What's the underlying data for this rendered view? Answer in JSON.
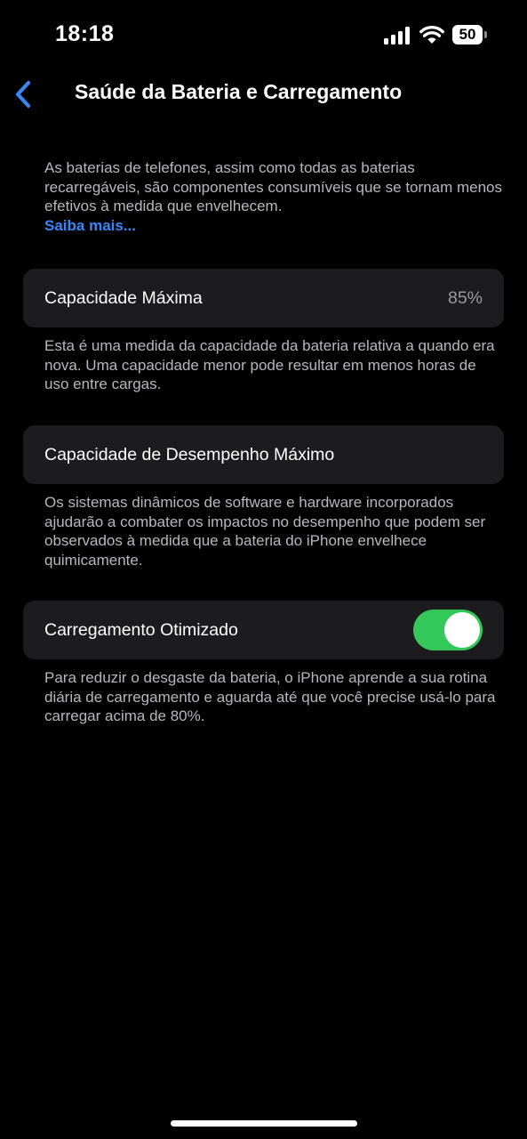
{
  "status_bar": {
    "time": "18:18",
    "battery_level": "50",
    "icons": [
      "signal-icon",
      "wifi-icon",
      "battery-icon"
    ]
  },
  "nav": {
    "back_icon": "chevron-left-icon",
    "title": "Saúde da Bateria e Carregamento"
  },
  "intro": {
    "text": "As baterias de telefones, assim como todas as baterias recarregáveis, são componentes consumíveis que se tornam menos efetivos à medida que envelhecem.",
    "link": "Saiba mais..."
  },
  "max_capacity": {
    "label": "Capacidade Máxima",
    "value": "85%",
    "footnote": "Esta é uma medida da capacidade da bateria relativa a quando era nova. Uma capacidade menor pode resultar em menos horas de uso entre cargas."
  },
  "peak_performance": {
    "label": "Capacidade de Desempenho Máximo",
    "footnote": "Os sistemas dinâmicos de software e hardware incorporados ajudarão a combater os impactos no desempenho que podem ser observados à medida que a bateria do iPhone envelhece quimicamente."
  },
  "optimized_charging": {
    "label": "Carregamento Otimizado",
    "enabled": true,
    "footnote": "Para reduzir o desgaste da bateria, o iPhone aprende a sua rotina diária de carregamento e aguarda até que você precise usá-lo para carregar acima de 80%."
  },
  "colors": {
    "background": "#000000",
    "cell": "#1c1c1e",
    "accent": "#3b86f5",
    "toggle_on": "#34c759",
    "secondary_text": "#b8b8bd"
  }
}
